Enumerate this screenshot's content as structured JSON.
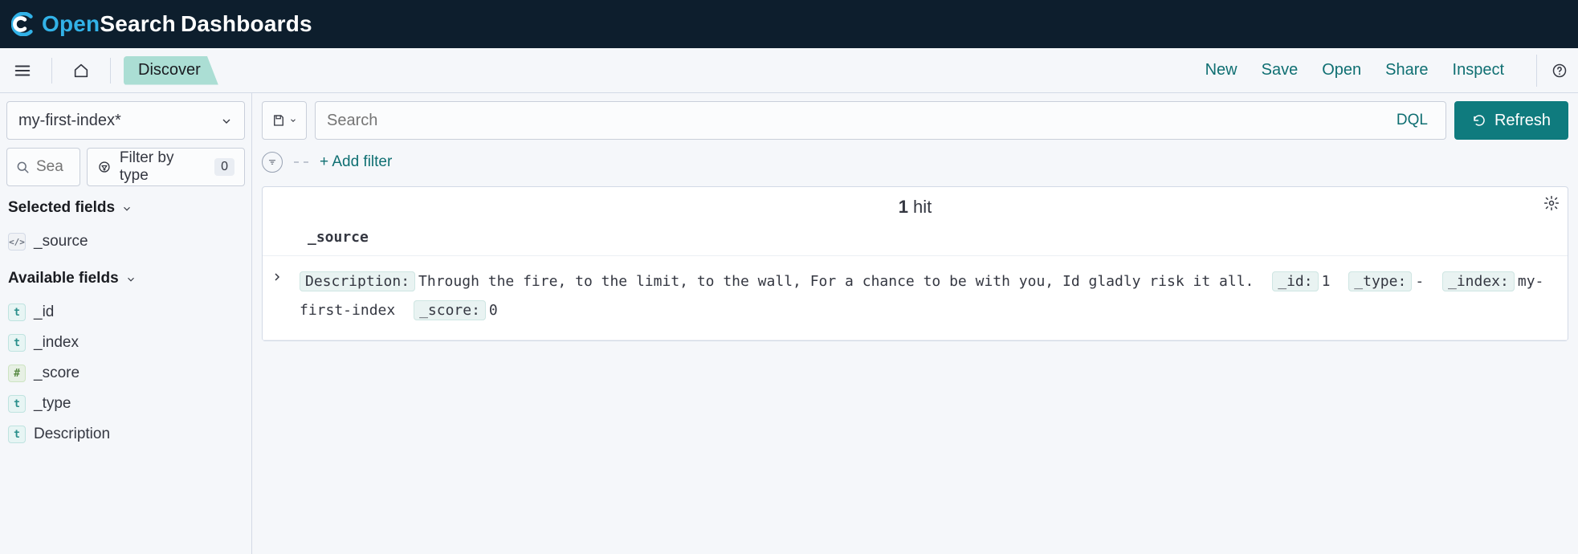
{
  "brand": {
    "open": "Open",
    "search": "Search",
    "dash": "Dashboards"
  },
  "toolbar": {
    "breadcrumb": "Discover",
    "links": {
      "new": "New",
      "save": "Save",
      "open": "Open",
      "share": "Share",
      "inspect": "Inspect"
    }
  },
  "sidebar": {
    "index_pattern": "my-first-index*",
    "field_search_placeholder": "Sea",
    "filter_type_label": "Filter by type",
    "filter_type_count": "0",
    "selected_label": "Selected fields",
    "available_label": "Available fields",
    "selected_fields": [
      {
        "type": "s",
        "name": "_source"
      }
    ],
    "available_fields": [
      {
        "type": "t",
        "name": "_id"
      },
      {
        "type": "t",
        "name": "_index"
      },
      {
        "type": "n",
        "name": "_score"
      },
      {
        "type": "t",
        "name": "_type"
      },
      {
        "type": "t",
        "name": "Description"
      }
    ]
  },
  "query": {
    "search_placeholder": "Search",
    "dql_label": "DQL",
    "refresh_label": "Refresh",
    "add_filter_label": "+ Add filter"
  },
  "results": {
    "hit_count": "1",
    "hit_suffix": " hit",
    "column": "_source",
    "doc": {
      "pairs": [
        {
          "k": "Description:",
          "v": "Through the fire, to the limit, to the wall, For a chance to be with you, Id gladly risk it all."
        },
        {
          "k": "_id:",
          "v": "1"
        },
        {
          "k": "_type:",
          "v": "-"
        },
        {
          "k": "_index:",
          "v": "my-first-index"
        },
        {
          "k": "_score:",
          "v": "0"
        }
      ]
    }
  }
}
